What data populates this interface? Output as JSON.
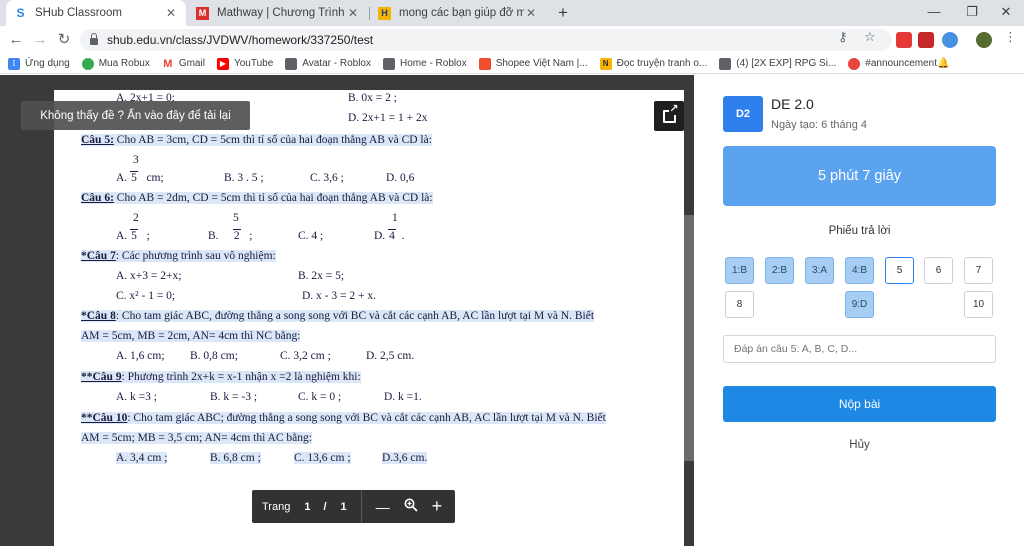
{
  "browser": {
    "tabs": [
      {
        "title": "SHub Classroom",
        "close": "✕"
      },
      {
        "title": "Mathway | Chương Trình Giải Bài",
        "close": "✕"
      },
      {
        "title": "mong các bạn giúp đỡ mik nha c",
        "close": "✕"
      }
    ],
    "new_tab": "+",
    "window_controls": {
      "minimize": "—",
      "maximize": "❐",
      "close": "✕"
    },
    "url": "shub.edu.vn/class/JVDWV/homework/337250/test",
    "bookmarks": [
      "Ứng dụng",
      "Mua Robux",
      "Gmail",
      "YouTube",
      "Avatar - Roblox",
      "Home - Roblox",
      "Shopee Việt Nam |...",
      "Đọc truyện tranh o...",
      "(4) [2X EXP] RPG Si...",
      "#announcement🔔"
    ]
  },
  "viewer": {
    "tooltip": "Không thấy đề ? Ấn vào đây để tải lại",
    "page_label": "Trang",
    "current_page": "1",
    "separator": "/",
    "total_pages": "1",
    "zoom_out": "—",
    "zoom_in": "+"
  },
  "document": {
    "lines": {
      "l1a": "A. 2x+1 = 0;",
      "l1b": "B. 0x = 2 ;",
      "l2b": "D. 2x+1 = 1 + 2x",
      "q5": "Câu 5:",
      "q5t": " Cho AB = 3cm, CD = 5cm thì tỉ số của hai đoạn thẳng AB và CD là:",
      "q5a": "A.",
      "q5a_num": "3",
      "q5a_den": "5",
      "q5a_unit": "cm;",
      "q5b": "B. 3 . 5  ;",
      "q5c": "C. 3,6 ;",
      "q5d": "D. 0,6",
      "q6": "Câu 6:",
      "q6t": " Cho AB = 2dm, CD = 5cm thì tỉ số của hai đoạn thẳng AB và CD là:",
      "q6a": "A.",
      "q6a_num": "2",
      "q6a_den": "5",
      "q6a_end": ";",
      "q6b": "B.",
      "q6b_num": "5",
      "q6b_den": "2",
      "q6b_end": ";",
      "q6c": "C. 4  ;",
      "q6d": "D.",
      "q6d_num": "1",
      "q6d_den": "4",
      "q6d_end": ".",
      "q7": "*Câu 7",
      "q7t": ": Các phương trình sau vô nghiệm:",
      "q7a": "A. x+3 = 2+x;",
      "q7b": "B. 2x = 5;",
      "q7c": "C. x² - 1 = 0;",
      "q7d": "D. x - 3 = 2 + x.",
      "q8": "*Câu 8",
      "q8t": ": Cho tam giác ABC, đường thẳng a song song với BC và cắt các cạnh AB, AC   lần lượt tại M và N. Biết",
      "q8t2": "AM = 5cm, MB = 2cm, AN= 4cm thì NC bằng:",
      "q8a": "A. 1,6 cm;",
      "q8b": "B. 0,8 cm;",
      "q8c": "C. 3,2 cm ;",
      "q8d": "D. 2,5 cm.",
      "q9": "**Câu 9",
      "q9t": ": Phương trình 2x+k = x-1 nhận x =2 là nghiệm khi:",
      "q9a": "A. k =3 ;",
      "q9b": "B. k = -3 ;",
      "q9c": "C. k = 0 ;",
      "q9d": "D. k =1.",
      "q10": "**Câu 10",
      "q10t": ": Cho tam giác ABC; đường thẳng a song song với BC và cắt các cạnh AB, AC lần lượt tại M và N. Biết",
      "q10t2": "AM = 5cm; MB = 3,5 cm; AN= 4cm thì AC bằng:",
      "q10a": "A. 3,4 cm ;",
      "q10b": "B. 6,8 cm ;",
      "q10c": "C. 13,6 cm ;",
      "q10d": "D.3,6 cm."
    }
  },
  "exam": {
    "badge": "D2",
    "title": "DE 2.0",
    "created": "Ngày tạo: 6 tháng 4",
    "timer": "5 phút 7 giây",
    "sheet_title": "Phiếu trả lời",
    "questions": [
      {
        "label": "1:B",
        "state": "done"
      },
      {
        "label": "2:B",
        "state": "done"
      },
      {
        "label": "3:A",
        "state": "done"
      },
      {
        "label": "4:B",
        "state": "done"
      },
      {
        "label": "5",
        "state": "cur"
      },
      {
        "label": "6",
        "state": "todo"
      },
      {
        "label": "7",
        "state": "todo"
      },
      {
        "label": "8",
        "state": "todo"
      },
      {
        "label": "9:D",
        "state": "done"
      },
      {
        "label": "10",
        "state": "todo"
      }
    ],
    "answer_placeholder": "Đáp án câu 5: A, B, C, D...",
    "submit": "Nộp bài",
    "cancel": "Hủy"
  },
  "colors": {
    "accent": "#2f80ed",
    "timer": "#5ba3ee",
    "submit": "#1e88e5",
    "answered": "#a6cdf3"
  }
}
